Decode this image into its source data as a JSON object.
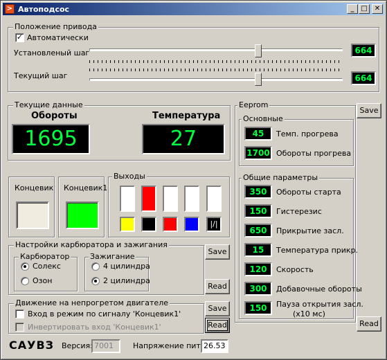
{
  "window": {
    "title": "Автоподсос",
    "min_glyph": "_",
    "max_glyph": "□",
    "close_glyph": "✕"
  },
  "drive": {
    "title": "Положение привода",
    "auto_label": "Автоматически",
    "auto_checked": true,
    "set_step_label": "Установленый шаг",
    "set_step_value": "664",
    "set_step_position": 0.67,
    "cur_step_label": "Текущий шаг",
    "cur_step_value": "664",
    "cur_step_position": 0.67
  },
  "current": {
    "title": "Текущие данные",
    "rpm_label": "Обороты",
    "rpm_value": "1695",
    "temp_label": "Температура",
    "temp_value": "27"
  },
  "switches": {
    "end1_label": "Концевик",
    "end1_color": "#f0ede0",
    "end2_label": "Концевик1",
    "end2_color": "#00ff00"
  },
  "outputs": {
    "title": "Выходы",
    "top_colors": [
      "#ffffff",
      "#ff0000",
      "#ffffff",
      "#ffffff",
      "#ffffff"
    ],
    "bottom_colors": [
      "#ffff00",
      "#000000",
      "#ff0000",
      "#0000ff",
      "#000000"
    ],
    "last_glyph": "|/|"
  },
  "carb": {
    "title": "Настройки карбюратора и зажигания",
    "carb_title": "Карбюратор",
    "opt_solex": "Солекс",
    "opt_ozon": "Озон",
    "ign_title": "Зажигание",
    "opt_4cyl": "4 цилиндра",
    "opt_2cyl": "2 цилиндра",
    "save_label": "Save",
    "read_label": "Read"
  },
  "cold": {
    "title": "Движение на непрогретом двигателе",
    "signal_label": "Вход в режим по сигналу 'Концевик1'",
    "invert_label": "Инвертировать вход 'Концевик1'",
    "save_label": "Save",
    "read_label": "Read"
  },
  "footer": {
    "brand": "САУВЗ",
    "version_label": "Версия:",
    "version_value": "7001",
    "voltage_label": "Напряжение пит.:",
    "voltage_value": "26.53"
  },
  "eeprom": {
    "title": "Eeprom",
    "save_label": "Save",
    "read_label": "Read",
    "basic_title": "Основные",
    "basic": [
      {
        "value": "45",
        "label": "Темп. прогрева"
      },
      {
        "value": "1700",
        "label": "Обороты прогрева"
      }
    ],
    "general_title": "Общие параметры",
    "general": [
      {
        "value": "350",
        "label": "Обороты старта"
      },
      {
        "value": "150",
        "label": "Гистерезис"
      },
      {
        "value": "650",
        "label": "Прикрытие засл."
      },
      {
        "value": "15",
        "label": "Температура прикр."
      },
      {
        "value": "120",
        "label": "Скорость"
      },
      {
        "value": "300",
        "label": "Добавочные обороты"
      },
      {
        "value": "150",
        "label": "Пауза открытия засл."
      }
    ],
    "pause_unit": "(x10 мс)"
  }
}
